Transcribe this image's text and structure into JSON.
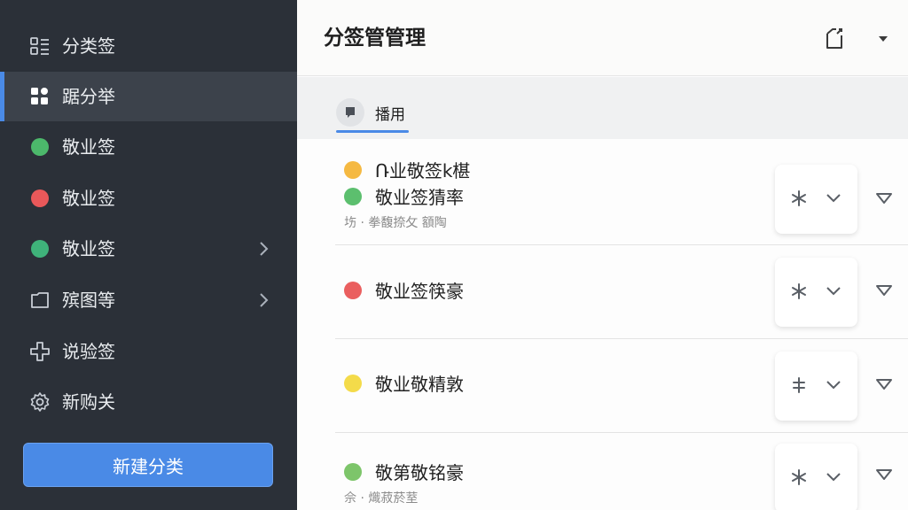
{
  "sidebar": {
    "items": [
      {
        "label": "分类签",
        "icon": "list-icon"
      },
      {
        "label": "踞分举",
        "icon": "grid-icon",
        "active": true
      },
      {
        "label": "敬业签",
        "icon": "green-dot",
        "color": "#4cb86b"
      },
      {
        "label": "敬业签",
        "icon": "red-dot",
        "color": "#e9585a"
      },
      {
        "label": "敬业签",
        "icon": "green-dot",
        "color": "#3fb27a"
      },
      {
        "label": "殡图等",
        "icon": "folder-icon"
      },
      {
        "label": "说验签",
        "icon": "plus-icon"
      },
      {
        "label": "新购关",
        "icon": "gear-icon"
      }
    ],
    "new_button": "新建分类"
  },
  "header": {
    "title": "分签管管理"
  },
  "tab": {
    "label": "播用"
  },
  "list": {
    "rows": [
      {
        "line1": "Ռ业敬签k椹",
        "line1_color": "#f5b942",
        "line2": "敬业签猜率",
        "line2_color": "#5cbf6e",
        "sub": "㘯 · 拳馥捺攵 額陶"
      },
      {
        "line1": "敬业签筷豪",
        "line1_color": "#ea5f5f"
      },
      {
        "line1": "敬业敬精敦",
        "line1_color": "#f4db4a"
      },
      {
        "line1": "敬第敬铭豪",
        "line1_color": "#7dc56a",
        "sub": "佘 · 熾菽菸荎"
      }
    ]
  }
}
